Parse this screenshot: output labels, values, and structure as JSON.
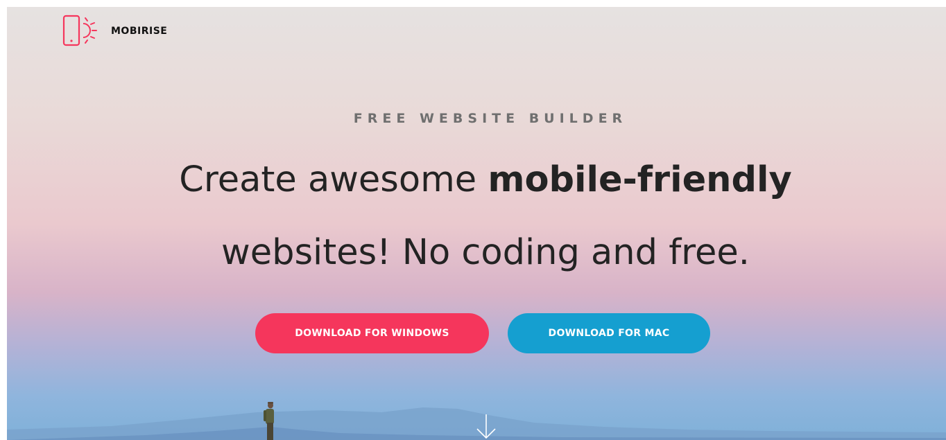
{
  "brand": {
    "name": "MOBIRISE",
    "icon": "phone-sun-logo-icon",
    "accent_color": "#f5365c"
  },
  "hero": {
    "kicker": "FREE WEBSITE BUILDER",
    "headline_line1_regular": "Create awesome ",
    "headline_line1_bold": "mobile-friendly",
    "headline_line2": "websites! No coding and free.",
    "buttons": {
      "windows": {
        "label": "DOWNLOAD FOR WINDOWS",
        "color": "#f5365c"
      },
      "mac": {
        "label": "DOWNLOAD FOR MAC",
        "color": "#159fd0"
      }
    },
    "scroll_icon": "arrow-down-icon"
  }
}
